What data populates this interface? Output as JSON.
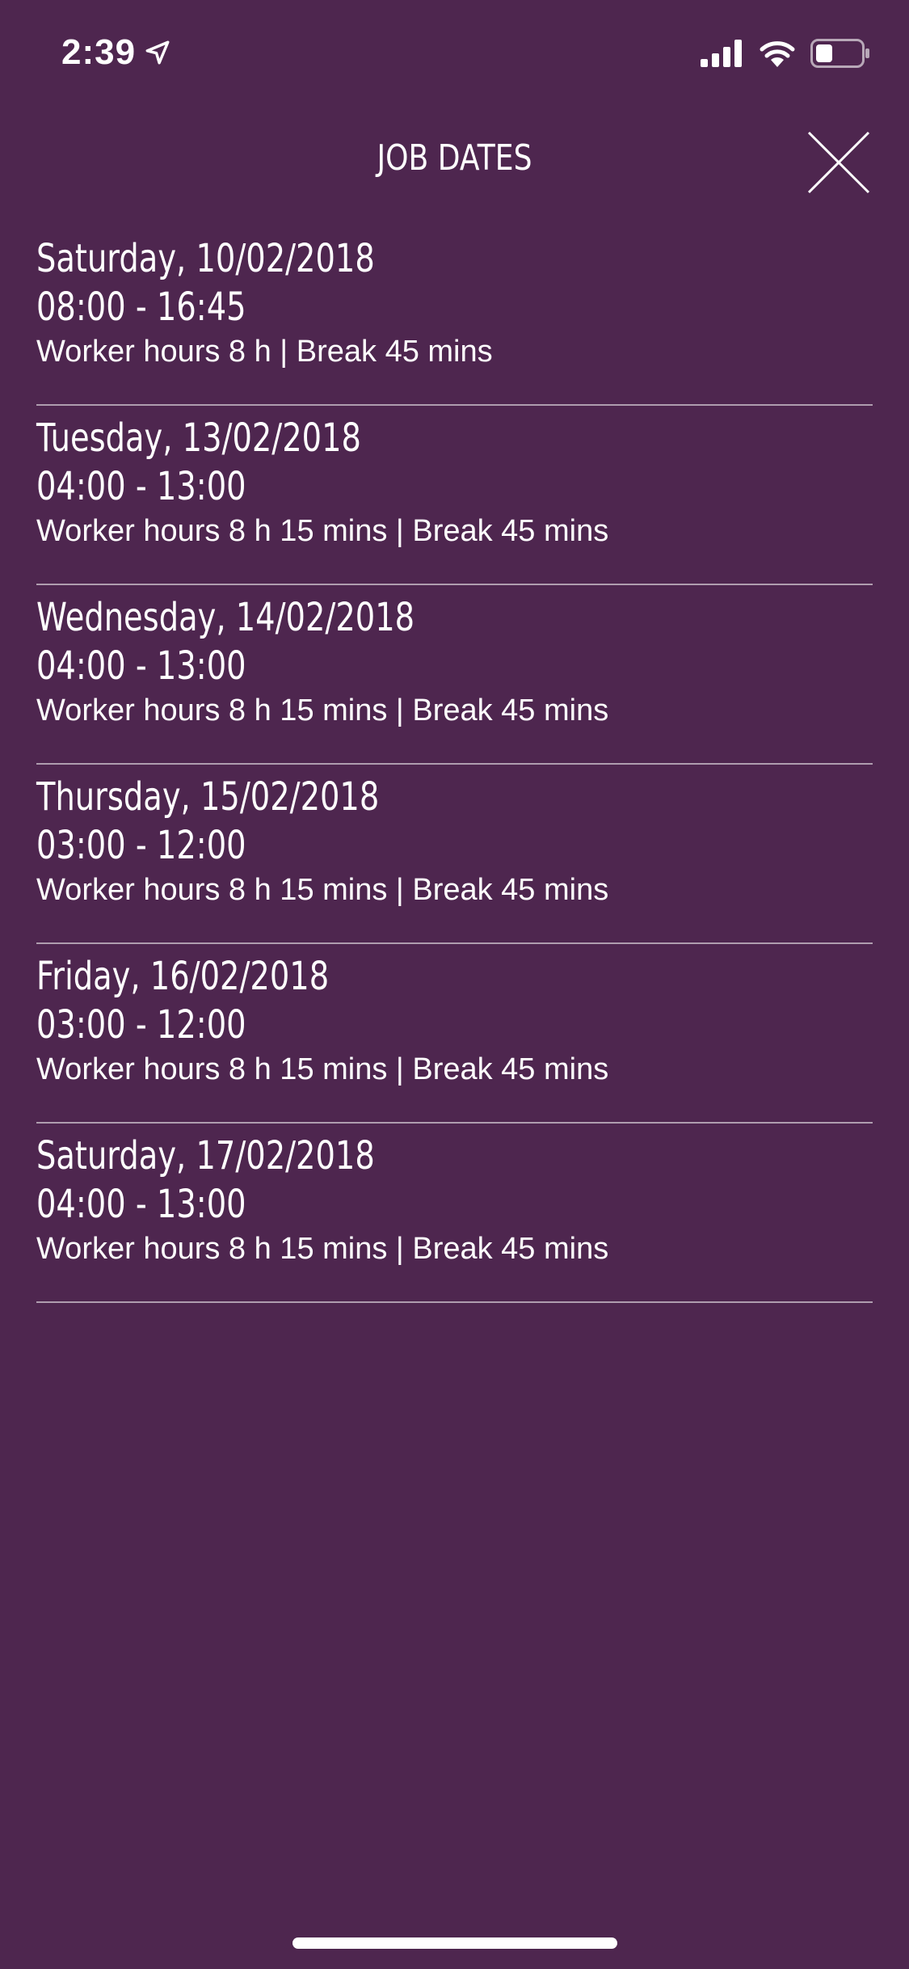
{
  "status_bar": {
    "time": "2:39"
  },
  "header": {
    "title": "JOB DATES"
  },
  "job_dates": [
    {
      "date": "Saturday, 10/02/2018",
      "time_range": "08:00 - 16:45",
      "details": "Worker hours 8 h | Break 45 mins"
    },
    {
      "date": "Tuesday, 13/02/2018",
      "time_range": "04:00 - 13:00",
      "details": "Worker hours 8 h 15 mins | Break 45 mins"
    },
    {
      "date": "Wednesday, 14/02/2018",
      "time_range": "04:00 - 13:00",
      "details": "Worker hours 8 h 15 mins | Break 45 mins"
    },
    {
      "date": "Thursday, 15/02/2018",
      "time_range": "03:00 - 12:00",
      "details": "Worker hours 8 h 15 mins | Break 45 mins"
    },
    {
      "date": "Friday, 16/02/2018",
      "time_range": "03:00 - 12:00",
      "details": "Worker hours 8 h 15 mins | Break 45 mins"
    },
    {
      "date": "Saturday, 17/02/2018",
      "time_range": "04:00 - 13:00",
      "details": "Worker hours 8 h 15 mins | Break 45 mins"
    }
  ],
  "icons": {
    "location": "location-arrow-icon",
    "signal": "cellular-signal-icon",
    "wifi": "wifi-icon",
    "battery": "battery-icon",
    "close": "close-icon"
  },
  "colors": {
    "background": "#4e264f",
    "text": "#ffffff"
  }
}
